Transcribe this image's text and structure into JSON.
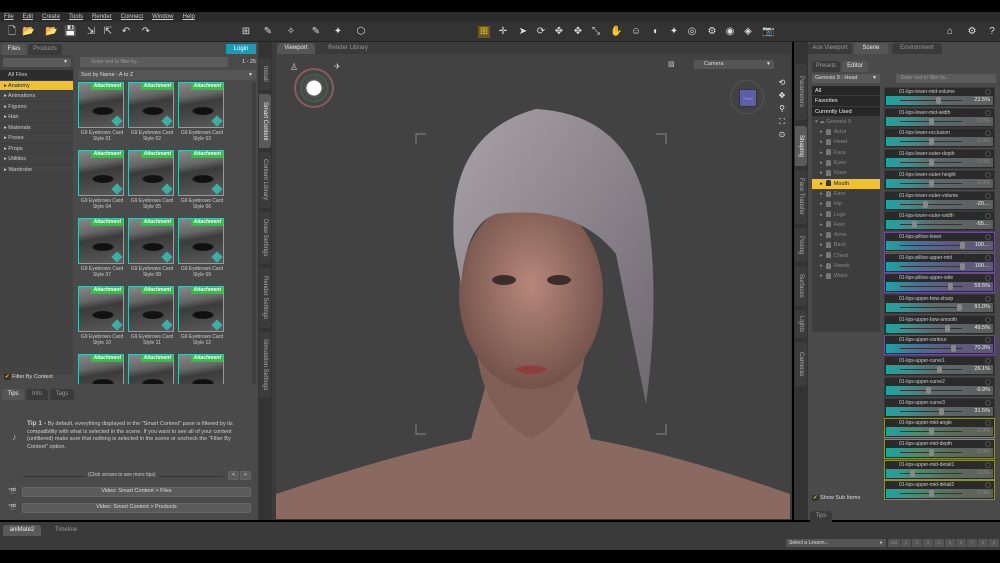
{
  "menu": [
    "File",
    "Edit",
    "Create",
    "Tools",
    "Render",
    "Connect",
    "Window",
    "Help"
  ],
  "left": {
    "tabs": [
      "Files",
      "Products"
    ],
    "login": "Login",
    "filter_placeholder": "Enter text to filter by...",
    "count": "1 - 25",
    "sort": "Sort by Name : A to Z",
    "categories": [
      "All Files",
      "Anatomy",
      "Animations",
      "Figures",
      "Hair",
      "Materials",
      "Poses",
      "Props",
      "Utilities",
      "Wardrobe"
    ],
    "selected_category": "Anatomy",
    "badge": "Attachment",
    "items": [
      "G9 Eyebrows Card Style 01",
      "G9 Eyebrows Card Style 02",
      "G9 Eyebrows Card Style 03",
      "G9 Eyebrows Card Style 04",
      "G9 Eyebrows Card Style 05",
      "G9 Eyebrows Card Style 06",
      "G9 Eyebrows Card Style 07",
      "G9 Eyebrows Card Style 08",
      "G9 Eyebrows Card Style 09",
      "G9 Eyebrows Card Style 10",
      "G9 Eyebrows Card Style 11",
      "G9 Eyebrows Card Style 12"
    ],
    "filter_by_context": "Filter By Context",
    "vtabs": [
      "Install",
      "Smart Content",
      "Content Library",
      "Draw Settings",
      "Render Settings",
      "Simulation Settings"
    ]
  },
  "tips": {
    "tabs": [
      "Tips",
      "Info",
      "Tags"
    ],
    "title": "Tip 1 -",
    "body": "By default, everything displayed in the \"Smart Content\" pane is filtered by its compatibility with what is selected in the scene. If you want to see all of your content (unfiltered) make sure that nothing is selected in the scene or uncheck the \"Filter By Context\" option.",
    "hint": "(Click arrows to see more tips)",
    "prev": "<",
    "next": ">",
    "video1": "Video: Smart Content > Files",
    "video2": "Video: Smart Content > Products"
  },
  "viewport": {
    "tabs": [
      "Viewport",
      "Render Library"
    ],
    "camera": "Camera",
    "cube_label": "Front"
  },
  "right": {
    "tabs": [
      "Aux Viewport",
      "Scene",
      "Environment"
    ],
    "subtabs": [
      "Presets",
      "Editor"
    ],
    "node_select": "Genesis 9 : Head",
    "filter_placeholder": "Enter text to filter by...",
    "groups": [
      "All",
      "Favorites",
      "Currently Used"
    ],
    "root": "Genesis 9",
    "nodes": [
      "Actor",
      "Head",
      "Face",
      "Eyes",
      "Nose",
      "Mouth",
      "Ears",
      "Hip",
      "Legs",
      "Feet",
      "Arms",
      "Back",
      "Chest",
      "Hands",
      "Waist"
    ],
    "selected_node": "Mouth",
    "vtabs": [
      "Parameters",
      "Shaping",
      "Face Transfer",
      "Posing",
      "Surfaces",
      "Lights",
      "Cameras"
    ],
    "sliders": [
      {
        "name": "01-lips-lower-mid-volume",
        "value": "22.5%",
        "pos": 0.61
      },
      {
        "name": "01-lips-lower-mid-width",
        "value": "0.0%",
        "pos": 0.5
      },
      {
        "name": "01-lips-lower-occlusion",
        "value": "0.0%",
        "pos": 0.5
      },
      {
        "name": "01-lips-lower-outer-depth",
        "value": "0.0%",
        "pos": 0.5
      },
      {
        "name": "01-lips-lower-outer-height",
        "value": "0.0%",
        "pos": 0.5
      },
      {
        "name": "01-lips-lower-outer-volume",
        "value": "-20....",
        "pos": 0.4
      },
      {
        "name": "01-lips-lower-outer-width",
        "value": "-55....",
        "pos": 0.22
      },
      {
        "name": "01-lips-pillow-lower",
        "value": "100....",
        "pos": 1.0
      },
      {
        "name": "01-lips-pillow-upper-mid",
        "value": "100....",
        "pos": 1.0
      },
      {
        "name": "01-lips-pillow-upper-side",
        "value": "59.5%",
        "pos": 0.8
      },
      {
        "name": "01-lips-upper-bow-sharp",
        "value": "91.0%",
        "pos": 0.95
      },
      {
        "name": "01-lips-upper-bow-smooth",
        "value": "49.5%",
        "pos": 0.75
      },
      {
        "name": "01-lips-upper-contour",
        "value": "70.3%",
        "pos": 0.85
      },
      {
        "name": "01-lips-upper-curve1",
        "value": "26.1%",
        "pos": 0.63
      },
      {
        "name": "01-lips-upper-curve2",
        "value": "-9.9%",
        "pos": 0.45
      },
      {
        "name": "01-lips-upper-curve3",
        "value": "31.5%",
        "pos": 0.66
      },
      {
        "name": "01-lips-upper-mid-angle",
        "value": "0.0%",
        "pos": 0.5
      },
      {
        "name": "01-lips-upper-mid-depth",
        "value": "0.0%",
        "pos": 0.5
      },
      {
        "name": "01-lips-upper-mid-detail1",
        "value": "0.0%",
        "pos": 0.2
      },
      {
        "name": "01-lips-upper-mid-detail2",
        "value": "0.0%",
        "pos": 0.5
      }
    ],
    "show_sub_items": "Show Sub Items",
    "tips_tab": "Tips"
  },
  "bottom": {
    "tabs": [
      "aniMate2",
      "Timeline"
    ],
    "lesson": "Select a Lesson...",
    "lesson_go": "Go",
    "steps": [
      "1",
      "2",
      "3",
      "4",
      "5",
      "6",
      "7",
      "8",
      "9"
    ]
  },
  "colors": {
    "accent": "#f2c12e",
    "teal": "#1aa5a0",
    "badge": "#22c93a"
  }
}
